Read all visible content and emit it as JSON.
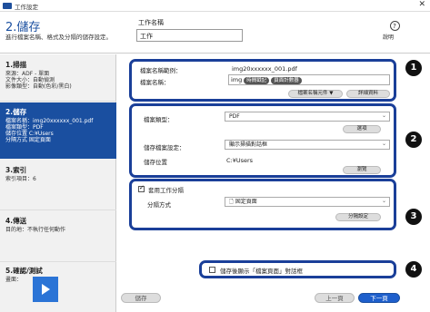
{
  "window": {
    "title": "工作設定",
    "close_glyph": "✕"
  },
  "header": {
    "title": "2.儲存",
    "description": "進行檔案名稱、格式及分隔的儲存設定。",
    "job_name_label": "工作名稱",
    "job_name_value": "工作",
    "help_label": "說明",
    "help_glyph": "?"
  },
  "sidebar": {
    "steps": [
      {
        "heading": "1.掃描",
        "lines": [
          "來源：ADF - 單面",
          "文件大小：自動偵測",
          "影像類型：自動(色彩/黑白)"
        ]
      },
      {
        "heading": "2.儲存",
        "lines": [
          "檔案名稱：img20xxxxxx_001.pdf",
          "檔案類型：PDF",
          "儲存位置 C:¥Users",
          "分隔方式 固定頁面"
        ]
      },
      {
        "heading": "3.索引",
        "lines": [
          "索引項目：6"
        ]
      },
      {
        "heading": "4.傳送",
        "lines": [
          "目的地：不執行任何動作"
        ]
      },
      {
        "heading": "5.確認/測試",
        "lines": [
          "畫面："
        ]
      }
    ]
  },
  "filename_section": {
    "example_label": "檔案名稱範例：",
    "example_value": "img20xxxxxx_001.pdf",
    "name_label": "檔案名稱：",
    "name_prefix": "img",
    "tag_auto_number": "時間戳記",
    "tag_page_count": "頁面計數器",
    "name_settings_button": "檔案名稱元件 ▼",
    "detail_button": "詳細資料",
    "badge": "1"
  },
  "save_section": {
    "file_type_label": "檔案類型：",
    "file_type_value": "PDF",
    "options_button": "選項",
    "save_method_label": "儲存檔案設定：",
    "save_method_value": "顯示掃描對話框",
    "location_label": "儲存位置",
    "location_value": "C:¥Users",
    "browse_button": "瀏覽",
    "badge": "2"
  },
  "separation_section": {
    "apply_label": "套用工作分隔",
    "apply_checked": true,
    "method_label": "分隔方式",
    "method_value": "固定頁面",
    "settings_button": "分隔設定",
    "badge": "3"
  },
  "notify_section": {
    "label": "儲存後顯示「檔案頁面」對話框",
    "checked": false,
    "badge": "4"
  },
  "footer": {
    "save_button": "儲存",
    "back_button": "上一頁",
    "next_button": "下一頁"
  },
  "colors": {
    "accent": "#1a4fa0",
    "box_border": "#1a3f99",
    "next_button": "#1e5fcc"
  }
}
